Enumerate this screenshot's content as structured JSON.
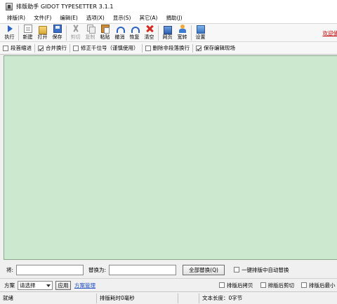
{
  "window": {
    "title": "排版助手 GIDOT TYPESETTER 3.1.1",
    "icon": "app-icon"
  },
  "menubar": [
    "排版(R)",
    "文件(F)",
    "编辑(E)",
    "选项(X)",
    "显示(S)",
    "其它(A)",
    "捐助(J)"
  ],
  "toolbar": {
    "buttons": [
      {
        "label": "执行",
        "icon": "play-icon",
        "enabled": true
      },
      {
        "label": "新建",
        "icon": "new-file-icon",
        "enabled": true
      },
      {
        "label": "打开",
        "icon": "folder-open-icon",
        "enabled": true
      },
      {
        "label": "保存",
        "icon": "save-icon",
        "enabled": true
      },
      {
        "label": "剪切",
        "icon": "scissors-icon",
        "enabled": false
      },
      {
        "label": "复制",
        "icon": "copy-icon",
        "enabled": false
      },
      {
        "label": "粘贴",
        "icon": "paste-icon",
        "enabled": true
      },
      {
        "label": "撤消",
        "icon": "undo-icon",
        "enabled": true
      },
      {
        "label": "恢复",
        "icon": "redo-icon",
        "enabled": true
      },
      {
        "label": "清空",
        "icon": "clear-icon",
        "enabled": true
      },
      {
        "label": "网页",
        "icon": "web-page-icon",
        "enabled": true
      },
      {
        "label": "宽转",
        "icon": "user-icon",
        "enabled": true
      },
      {
        "label": "设置",
        "icon": "settings-icon",
        "enabled": true
      }
    ],
    "welcome_link": "欢迎使"
  },
  "options": [
    {
      "label": "段首缩进",
      "checked": false
    },
    {
      "label": "合并换行",
      "checked": true
    },
    {
      "label": "修正千位号（谨慎使用）",
      "checked": false
    },
    {
      "label": "删除非段落换行",
      "checked": false
    },
    {
      "label": "保存编辑现场",
      "checked": true
    }
  ],
  "editor": {
    "content": "",
    "background": "#cce8cf"
  },
  "replace": {
    "find_label": "将:",
    "find_value": "",
    "replace_label": "替换为:",
    "replace_value": "",
    "replace_all_label": "全部替换(Q)",
    "auto_replace_label": "一键排版中自动替换",
    "auto_replace_checked": false
  },
  "scheme": {
    "label": "方案",
    "selected": "请选择",
    "apply_label": "应用",
    "manage_link": "方案管理",
    "checks": [
      {
        "label": "排版后拷贝",
        "checked": false
      },
      {
        "label": "排版后剪切",
        "checked": false
      },
      {
        "label": "排版后最小",
        "checked": false
      }
    ]
  },
  "status": {
    "state": "就绪",
    "timing": "排版耗时0毫秒",
    "length": "文本长度：0字节"
  }
}
